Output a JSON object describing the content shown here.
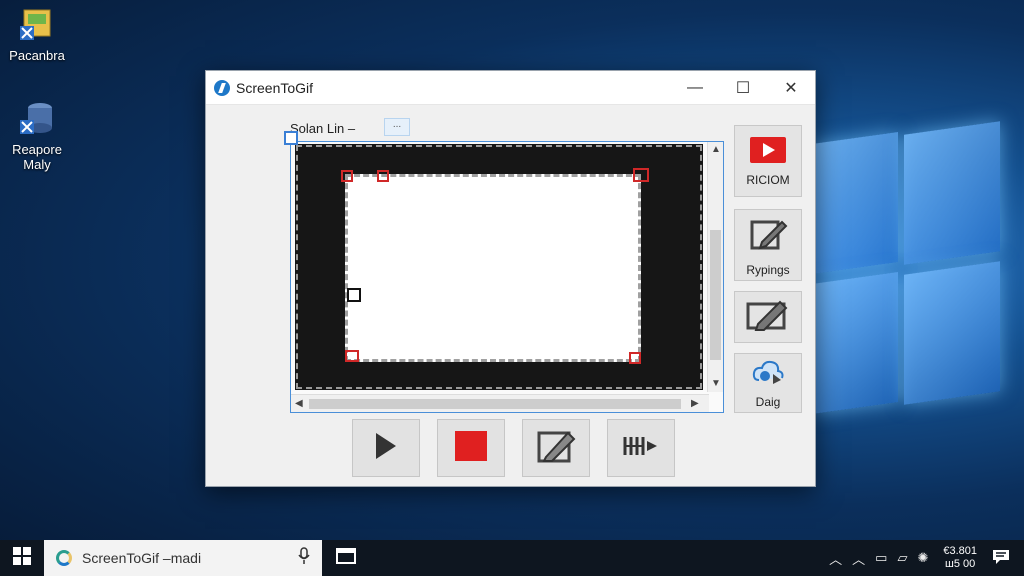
{
  "desktop": {
    "icons": [
      {
        "label": "Pacanbra"
      },
      {
        "label": "Reapore\nMaly"
      }
    ]
  },
  "window": {
    "title": "ScreenToGif",
    "controls": {
      "minimize": "—",
      "maximize": "☐",
      "close": "✕"
    }
  },
  "selection": {
    "label": "Solan Lin –",
    "box_text": "..."
  },
  "side_buttons": [
    {
      "label": "RICIOM",
      "icon": "record-icon"
    },
    {
      "label": "Rypings",
      "icon": "edit-icon"
    },
    {
      "label": "",
      "icon": "pencil-icon"
    },
    {
      "label": "Daig",
      "icon": "cloud-icon"
    }
  ],
  "bottom_buttons": [
    {
      "icon": "play-icon"
    },
    {
      "icon": "stop-icon"
    },
    {
      "icon": "edit-icon"
    },
    {
      "icon": "split-icon"
    }
  ],
  "taskbar": {
    "search_text": "ScreenToGif –madi",
    "clock_line1": "€3.801",
    "clock_line2": "ш5 00"
  },
  "colors": {
    "record_red": "#e02020",
    "accent_blue": "#3a7fd5"
  }
}
